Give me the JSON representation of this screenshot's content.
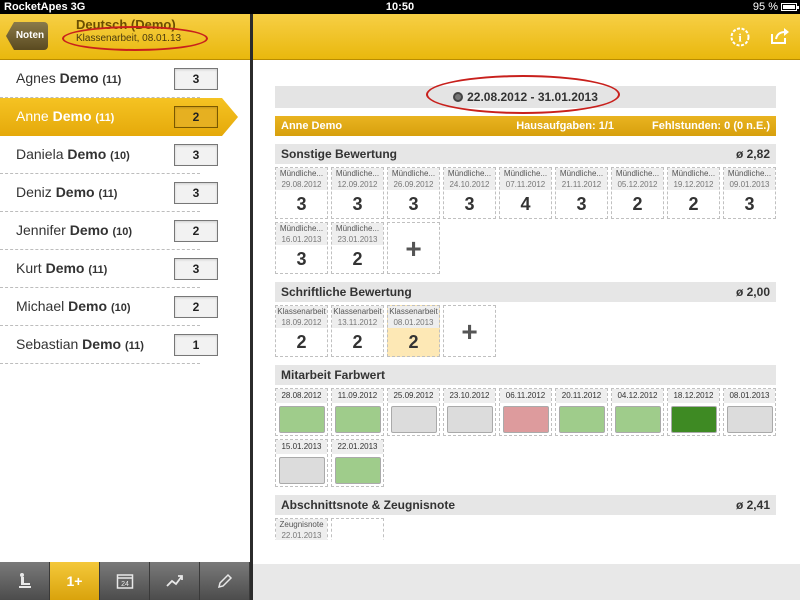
{
  "status_bar": {
    "carrier": "RocketApes 3G",
    "time": "10:50",
    "battery": "95 %"
  },
  "left": {
    "back_label": "Noten",
    "title": "Deutsch (Demo)",
    "subtitle": "Klassenarbeit, 08.01.13",
    "students": [
      {
        "first": "Agnes",
        "last": "Demo",
        "count": "(11)",
        "grade": "3"
      },
      {
        "first": "Anne",
        "last": "Demo",
        "count": "(11)",
        "grade": "2"
      },
      {
        "first": "Daniela",
        "last": "Demo",
        "count": "(10)",
        "grade": "3"
      },
      {
        "first": "Deniz",
        "last": "Demo",
        "count": "(11)",
        "grade": "3"
      },
      {
        "first": "Jennifer",
        "last": "Demo",
        "count": "(10)",
        "grade": "2"
      },
      {
        "first": "Kurt",
        "last": "Demo",
        "count": "(11)",
        "grade": "3"
      },
      {
        "first": "Michael",
        "last": "Demo",
        "count": "(10)",
        "grade": "2"
      },
      {
        "first": "Sebastian",
        "last": "Demo",
        "count": "(11)",
        "grade": "1"
      }
    ],
    "tabs": [
      {
        "icon": "seat-icon",
        "label": ""
      },
      {
        "icon": "grade-icon",
        "label": "1+"
      },
      {
        "icon": "calendar-icon",
        "label": "24"
      },
      {
        "icon": "trend-chart-icon",
        "label": ""
      },
      {
        "icon": "pencil-icon",
        "label": ""
      }
    ]
  },
  "right": {
    "date_range": "22.08.2012 - 31.01.2013",
    "student_name": "Anne Demo",
    "homework": "Hausaufgaben: 1/1",
    "absences": "Fehlstunden: 0 (0 n.E.)",
    "sonstige": {
      "title": "Sonstige Bewertung",
      "avg": "ø 2,82",
      "entries": [
        {
          "label": "Mündliche...",
          "date": "29.08.2012",
          "grade": "3"
        },
        {
          "label": "Mündliche...",
          "date": "12.09.2012",
          "grade": "3"
        },
        {
          "label": "Mündliche...",
          "date": "26.09.2012",
          "grade": "3"
        },
        {
          "label": "Mündliche...",
          "date": "24.10.2012",
          "grade": "3"
        },
        {
          "label": "Mündliche...",
          "date": "07.11.2012",
          "grade": "4"
        },
        {
          "label": "Mündliche...",
          "date": "21.11.2012",
          "grade": "3"
        },
        {
          "label": "Mündliche...",
          "date": "05.12.2012",
          "grade": "2"
        },
        {
          "label": "Mündliche...",
          "date": "19.12.2012",
          "grade": "2"
        },
        {
          "label": "Mündliche...",
          "date": "09.01.2013",
          "grade": "3"
        },
        {
          "label": "Mündliche...",
          "date": "16.01.2013",
          "grade": "3"
        },
        {
          "label": "Mündliche...",
          "date": "23.01.2013",
          "grade": "2"
        }
      ]
    },
    "schriftlich": {
      "title": "Schriftliche Bewertung",
      "avg": "ø 2,00",
      "entries": [
        {
          "label": "Klassenarbeit",
          "date": "18.09.2012",
          "grade": "2"
        },
        {
          "label": "Klassenarbeit",
          "date": "13.11.2012",
          "grade": "2"
        },
        {
          "label": "Klassenarbeit",
          "date": "08.01.2013",
          "grade": "2"
        }
      ]
    },
    "mitarbeit": {
      "title": "Mitarbeit Farbwert",
      "entries": [
        {
          "date": "28.08.2012",
          "color": "#9fcc8b"
        },
        {
          "date": "11.09.2012",
          "color": "#9fcc8b"
        },
        {
          "date": "25.09.2012",
          "color": "#dcdcdc"
        },
        {
          "date": "23.10.2012",
          "color": "#dcdcdc"
        },
        {
          "date": "06.11.2012",
          "color": "#dd9b9d"
        },
        {
          "date": "20.11.2012",
          "color": "#9fcc8b"
        },
        {
          "date": "04.12.2012",
          "color": "#9fcc8b"
        },
        {
          "date": "18.12.2012",
          "color": "#3e8a23"
        },
        {
          "date": "08.01.2013",
          "color": "#dcdcdc"
        },
        {
          "date": "15.01.2013",
          "color": "#dcdcdc"
        },
        {
          "date": "22.01.2013",
          "color": "#9fcc8b"
        }
      ]
    },
    "abschnitt": {
      "title": "Abschnittsnote & Zeugnisnote",
      "avg": "ø 2,41",
      "label": "Zeugnisnote",
      "date": "22.01.2013"
    }
  },
  "colors": {
    "accent": "#e9b80d",
    "annotation": "#c8201c"
  }
}
